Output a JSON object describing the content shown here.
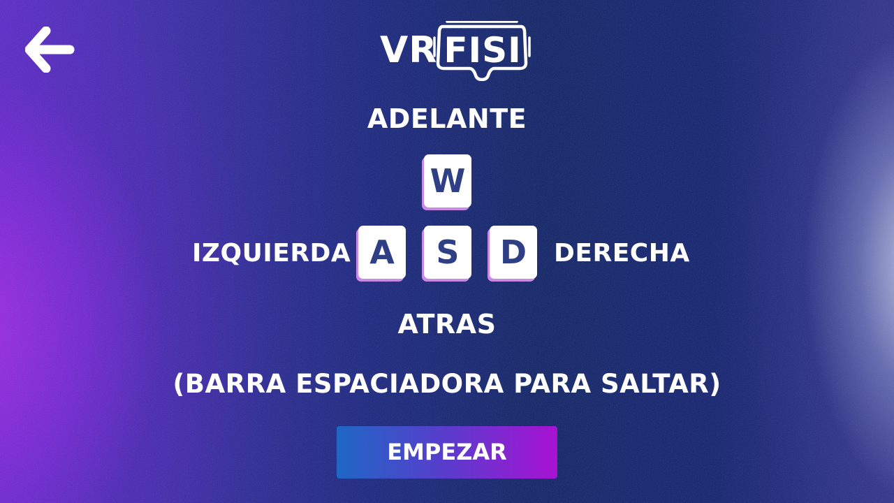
{
  "header": {
    "back_icon": "arrow-left-icon",
    "logo": {
      "prefix": "VR",
      "name": "FISI",
      "icon": "vr-goggles-icon"
    }
  },
  "controls": {
    "forward_label": "ADELANTE",
    "left_label": "IZQUIERDA",
    "right_label": "DERECHA",
    "back_label": "ATRAS",
    "keys": {
      "up": "W",
      "left": "A",
      "down": "S",
      "right": "D"
    },
    "jump_hint": "(BARRA ESPACIADORA PARA SALTAR)"
  },
  "actions": {
    "start_label": "EMPEZAR"
  },
  "colors": {
    "key_text": "#2e3f86",
    "key_shadow": "#c98ae6",
    "button_gradient_start": "#1f67c4",
    "button_gradient_end": "#a912d4"
  }
}
